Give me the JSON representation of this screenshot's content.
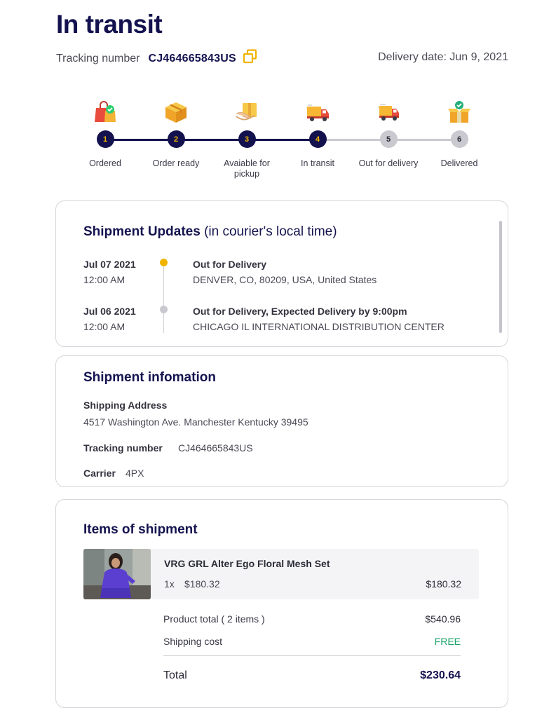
{
  "header": {
    "title": "In transit",
    "tracking_label": "Tracking number",
    "tracking_number": "CJ464665843US",
    "delivery_date": "Delivery date: Jun 9, 2021"
  },
  "colors": {
    "navy": "#14134f",
    "accent": "#f0b400",
    "inactive": "#c9c9cf",
    "free": "#1ea36b"
  },
  "progress": {
    "completed_steps": 4,
    "total_steps": 6
  },
  "steps": [
    {
      "num": "1",
      "label": "Ordered",
      "icon": "shopping-bag-icon",
      "done": true
    },
    {
      "num": "2",
      "label": "Order ready",
      "icon": "package-box-icon",
      "done": true
    },
    {
      "num": "3",
      "label": "Avaiable for pickup",
      "icon": "hand-package-icon",
      "done": true
    },
    {
      "num": "4",
      "label": "In transit",
      "icon": "delivery-truck-icon",
      "done": true
    },
    {
      "num": "5",
      "label": "Out for delivery",
      "icon": "fast-truck-icon",
      "done": false
    },
    {
      "num": "6",
      "label": "Delivered",
      "icon": "open-box-check-icon",
      "done": false
    }
  ],
  "updates": {
    "title": "Shipment Updates",
    "subtitle": "(in courier's local time)",
    "entries": [
      {
        "date": "Jul 07 2021",
        "time": "12:00 AM",
        "status": "Out for Delivery",
        "location": "DENVER, CO, 80209, USA, United States"
      },
      {
        "date": "Jul 06 2021",
        "time": "12:00 AM",
        "status": "Out for Delivery, Expected Delivery by 9:00pm",
        "location": "CHICAGO IL INTERNATIONAL DISTRIBUTION CENTER"
      }
    ]
  },
  "info": {
    "title": "Shipment infomation",
    "address_label": "Shipping Address",
    "address": "4517 Washington Ave. Manchester Kentucky 39495",
    "tracking_label": "Tracking number",
    "tracking_value": "CJ464665843US",
    "carrier_label": "Carrier",
    "carrier_value": "4PX"
  },
  "items": {
    "title": "Items of shipment",
    "list": [
      {
        "name": "VRG GRL Alter Ego Floral Mesh Set",
        "qty": "1x",
        "unit_price": "$180.32",
        "price": "$180.32"
      }
    ],
    "product_total_label": "Product total ( 2 items )",
    "product_total": "$540.96",
    "shipping_label": "Shipping cost",
    "shipping_value": "FREE",
    "total_label": "Total",
    "total_value": "$230.64"
  }
}
